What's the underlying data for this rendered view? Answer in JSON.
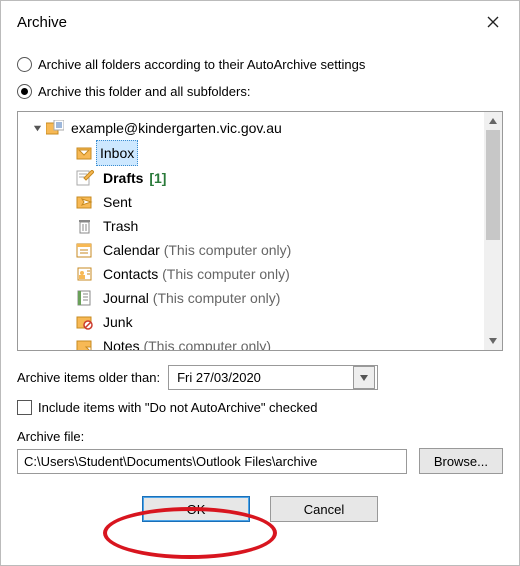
{
  "window": {
    "title": "Archive"
  },
  "options": {
    "allFolders": "Archive all folders according to their AutoArchive settings",
    "thisFolder": "Archive this folder and all subfolders:"
  },
  "tree": {
    "root": "example@kindergarten.vic.gov.au",
    "items": {
      "inbox": "Inbox",
      "drafts": "Drafts",
      "draftsCount": "[1]",
      "sent": "Sent",
      "trash": "Trash",
      "calendar": "Calendar",
      "contacts": "Contacts",
      "journal": "Journal",
      "junk": "Junk",
      "notes": "Notes",
      "localSuffix": " (This computer only)"
    }
  },
  "olderThan": {
    "label": "Archive items older than:",
    "value": "Fri 27/03/2020"
  },
  "includeCheckbox": "Include items with \"Do not AutoArchive\" checked",
  "archiveFile": {
    "label": "Archive file:",
    "path": "C:\\Users\\Student\\Documents\\Outlook Files\\archive",
    "browse": "Browse..."
  },
  "buttons": {
    "ok": "OK",
    "cancel": "Cancel"
  }
}
